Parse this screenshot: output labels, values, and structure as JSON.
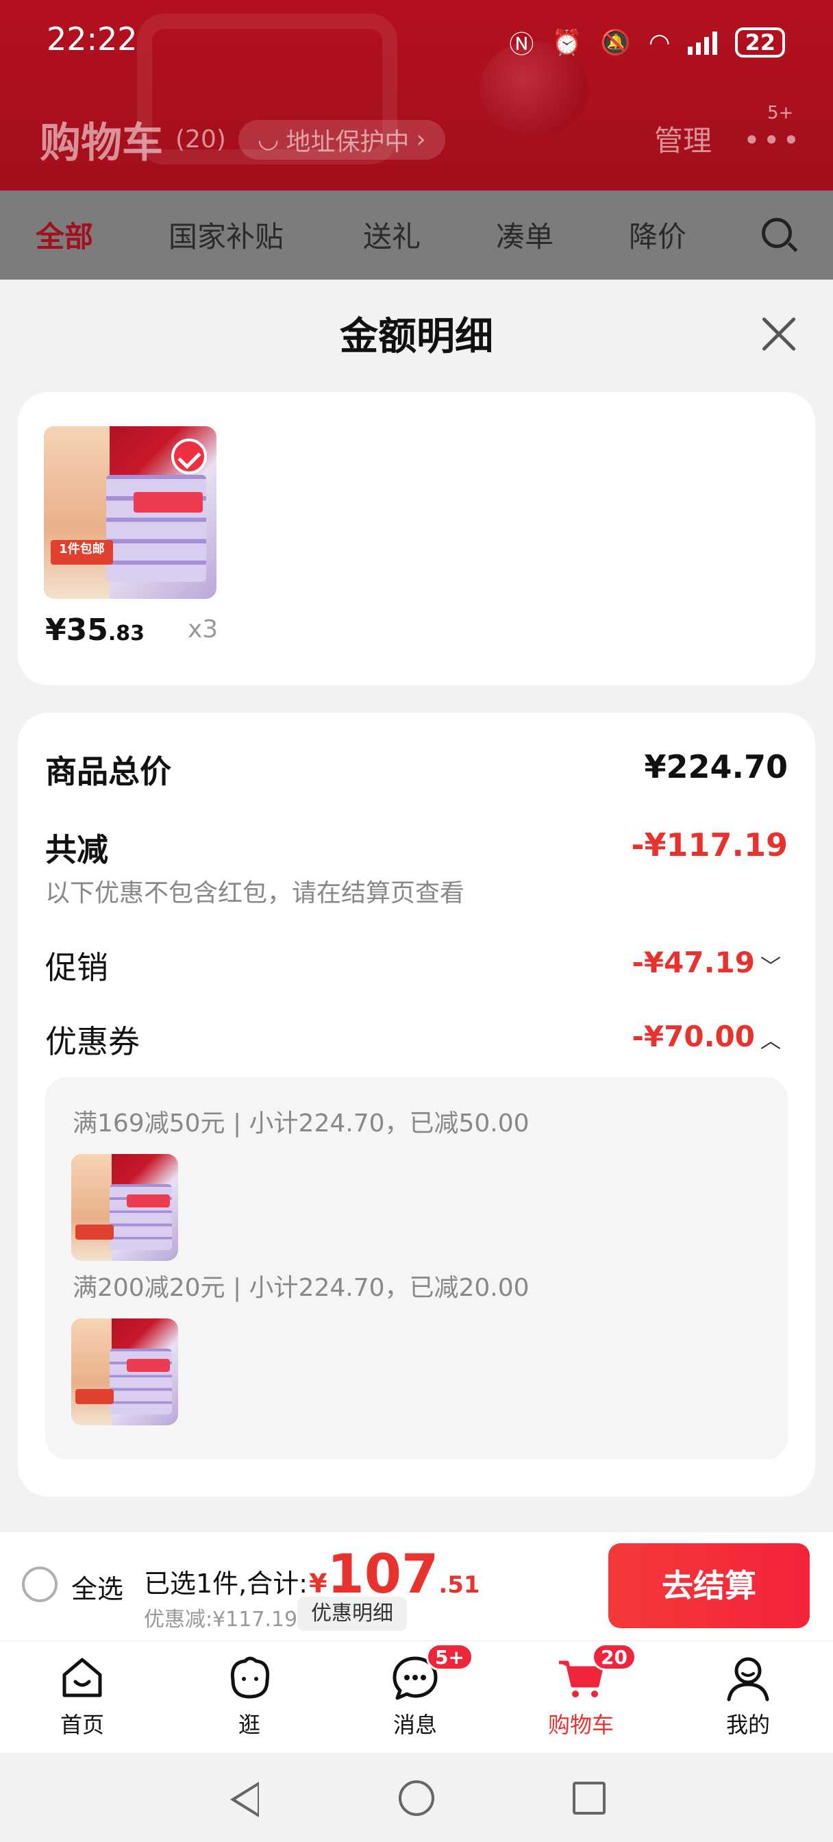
{
  "status_bar": {
    "time": "22:22",
    "battery": "22",
    "icons": [
      "nfc-icon",
      "alarm-icon",
      "mute-icon",
      "wifi-6-icon",
      "signal-icon",
      "battery-icon"
    ]
  },
  "header": {
    "title": "购物车",
    "count": "(20)",
    "address_protect": "地址保护中",
    "manage": "管理",
    "more_badge": "5+"
  },
  "filters": {
    "tabs": [
      "全部",
      "国家补贴",
      "送礼",
      "凑单",
      "降价"
    ],
    "active": "全部"
  },
  "sheet": {
    "title": "金额明细",
    "product": {
      "price_int": "¥35",
      "price_dec": ".83",
      "quantity": "x3",
      "image_tag": "1件包邮"
    },
    "total_label": "商品总价",
    "total_value": "¥224.70",
    "reduce_label": "共减",
    "reduce_value": "-¥117.19",
    "reduce_note": "以下优惠不包含红包，请在结算页查看",
    "promo_label": "促销",
    "promo_value": "-¥47.19",
    "coupon_label": "优惠券",
    "coupon_value": "-¥70.00",
    "coupons": [
      {
        "text": "满169减50元 | 小计224.70，已减50.00"
      },
      {
        "text": "满200减20元 | 小计224.70，已减20.00"
      }
    ]
  },
  "checkout": {
    "select_all": "全选",
    "selected_prefix": "已选1件,合计:",
    "currency": "¥",
    "total_int": "107",
    "total_dec": ".51",
    "discount": "优惠减:¥117.19",
    "detail_btn": "优惠明细",
    "checkout_btn": "去结算"
  },
  "tabbar": {
    "tabs": [
      {
        "label": "首页",
        "icon": "home-icon"
      },
      {
        "label": "逛",
        "icon": "browse-icon"
      },
      {
        "label": "消息",
        "icon": "message-icon",
        "badge": "5+"
      },
      {
        "label": "购物车",
        "icon": "cart-icon",
        "badge": "20"
      },
      {
        "label": "我的",
        "icon": "profile-icon"
      }
    ],
    "active": "购物车"
  },
  "colors": {
    "brand_red": "#e8322e",
    "header_red": "#a30f1c",
    "checkout_gradient": "#f33a3a"
  }
}
